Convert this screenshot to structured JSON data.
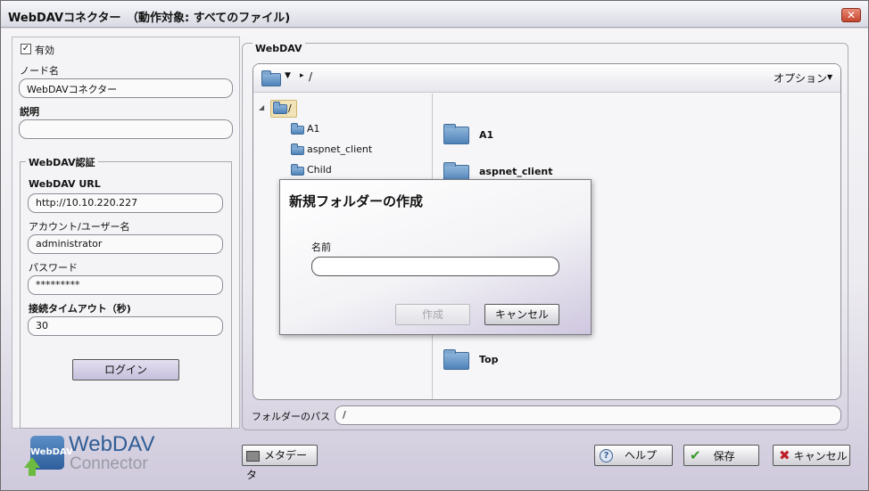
{
  "window": {
    "title": "WebDAVコネクター　（動作対象: すべてのファイル)",
    "close_glyph": "✕"
  },
  "left": {
    "enabled_label": "有効",
    "enabled_checked": true,
    "node_name_label": "ノード名",
    "node_name_value": "WebDAVコネクター",
    "description_label": "説明",
    "description_value": "",
    "auth_group_title": "WebDAV認証",
    "url_label": "WebDAV URL",
    "url_value": "http://10.10.220.227",
    "account_label": "アカウント/ユーザー名",
    "account_value": "administrator",
    "password_label": "パスワード",
    "password_value": "*********",
    "timeout_label": "接続タイムアウト（秒)",
    "timeout_value": "30",
    "login_button": "ログイン"
  },
  "webdav": {
    "group_title": "WebDAV",
    "toolbar_path": "/",
    "options_label": "オプション",
    "tree": {
      "root": "/",
      "children": [
        "A1",
        "aspnet_client",
        "Child"
      ]
    },
    "grid_items": [
      "A1",
      "aspnet_client",
      "Top"
    ],
    "folder_path_label": "フォルダーのパス",
    "folder_path_value": "/"
  },
  "modal": {
    "title": "新規フォルダーの作成",
    "name_label": "名前",
    "name_value": "",
    "create_button": "作成",
    "cancel_button": "キャンセル"
  },
  "footer": {
    "logo_badge": "WebDAV",
    "logo_line1": "WebDAV",
    "logo_line2": "Connector",
    "metadata_button": "メタデータ",
    "help_button": "ヘルプ",
    "save_button": "保存",
    "cancel_button": "キャンセル"
  },
  "colors": {
    "accent_purple": "#cfc7df",
    "folder_blue": "#4f82b8",
    "save_check": "#3a9a2a",
    "cancel_x": "#c0202a"
  }
}
